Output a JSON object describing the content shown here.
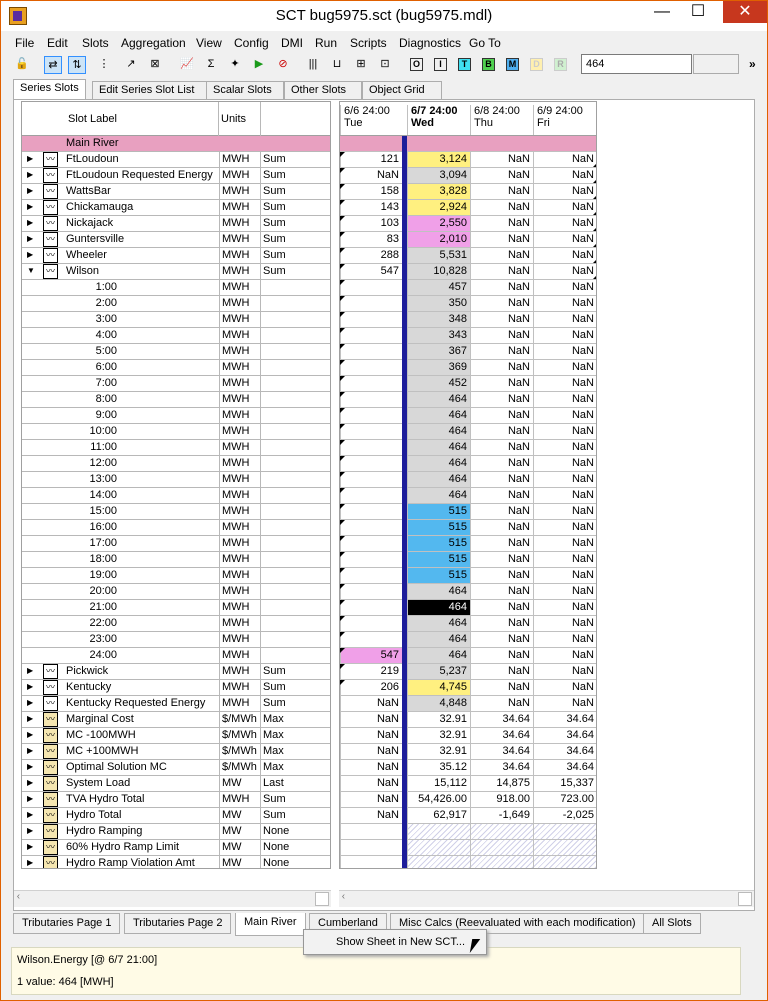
{
  "window": {
    "title": "SCT bug5975.sct (bug5975.mdl)",
    "min": "—",
    "max": "☐",
    "close": "✕"
  },
  "menu": [
    "File",
    "Edit",
    "Slots",
    "Aggregation",
    "View",
    "Config",
    "DMI",
    "Run",
    "Scripts",
    "Diagnostics",
    "Go To"
  ],
  "toolbar": {
    "search_value": "464",
    "boxes": [
      "O",
      "I",
      "T",
      "B",
      "M",
      "D",
      "R"
    ]
  },
  "top_tabs": [
    "Series Slots",
    "Edit Series Slot List",
    "Scalar Slots",
    "Other Slots",
    "Object Grid"
  ],
  "columns": {
    "slot_label": "Slot Label",
    "units": "Units"
  },
  "dates": [
    {
      "d": "6/6 24:00",
      "w": "Tue"
    },
    {
      "d": "6/7 24:00",
      "w": "Wed"
    },
    {
      "d": "6/8 24:00",
      "w": "Thu"
    },
    {
      "d": "6/9 24:00",
      "w": "Fri"
    }
  ],
  "rows": [
    {
      "label": "Main River",
      "type": "main"
    },
    {
      "label": "FtLoudoun",
      "units": "MWH",
      "agg": "Sum",
      "arrow": "▶",
      "icon": "n",
      "v": [
        "121",
        "3,124",
        "NaN",
        "NaN"
      ],
      "c1": "yellow"
    },
    {
      "label": "FtLoudoun Requested Energy",
      "units": "MWH",
      "agg": "Sum",
      "arrow": "▶",
      "icon": "n",
      "v": [
        "NaN",
        "3,094",
        "NaN",
        "NaN"
      ],
      "c1": ""
    },
    {
      "label": "WattsBar",
      "units": "MWH",
      "agg": "Sum",
      "arrow": "▶",
      "icon": "n",
      "v": [
        "158",
        "3,828",
        "NaN",
        "NaN"
      ],
      "c1": "yellow"
    },
    {
      "label": "Chickamauga",
      "units": "MWH",
      "agg": "Sum",
      "arrow": "▶",
      "icon": "n",
      "v": [
        "143",
        "2,924",
        "NaN",
        "NaN"
      ],
      "c1": "yellow"
    },
    {
      "label": "Nickajack",
      "units": "MWH",
      "agg": "Sum",
      "arrow": "▶",
      "icon": "n",
      "v": [
        "103",
        "2,550",
        "NaN",
        "NaN"
      ],
      "c1": "pink"
    },
    {
      "label": "Guntersville",
      "units": "MWH",
      "agg": "Sum",
      "arrow": "▶",
      "icon": "n",
      "v": [
        "83",
        "2,010",
        "NaN",
        "NaN"
      ],
      "c1": "pink"
    },
    {
      "label": "Wheeler",
      "units": "MWH",
      "agg": "Sum",
      "arrow": "▶",
      "icon": "n",
      "v": [
        "288",
        "5,531",
        "NaN",
        "NaN"
      ],
      "c1": ""
    },
    {
      "label": "Wilson",
      "units": "MWH",
      "agg": "Sum",
      "arrow": "▼",
      "icon": "n",
      "v": [
        "547",
        "10,828",
        "NaN",
        "NaN"
      ],
      "c1": ""
    },
    {
      "label": "1:00",
      "units": "MWH",
      "ts": 1,
      "v": [
        "",
        "457",
        "NaN",
        "NaN"
      ],
      "c1": ""
    },
    {
      "label": "2:00",
      "units": "MWH",
      "ts": 1,
      "v": [
        "",
        "350",
        "NaN",
        "NaN"
      ],
      "c1": ""
    },
    {
      "label": "3:00",
      "units": "MWH",
      "ts": 1,
      "v": [
        "",
        "348",
        "NaN",
        "NaN"
      ],
      "c1": ""
    },
    {
      "label": "4:00",
      "units": "MWH",
      "ts": 1,
      "v": [
        "",
        "343",
        "NaN",
        "NaN"
      ],
      "c1": ""
    },
    {
      "label": "5:00",
      "units": "MWH",
      "ts": 1,
      "v": [
        "",
        "367",
        "NaN",
        "NaN"
      ],
      "c1": ""
    },
    {
      "label": "6:00",
      "units": "MWH",
      "ts": 1,
      "v": [
        "",
        "369",
        "NaN",
        "NaN"
      ],
      "c1": ""
    },
    {
      "label": "7:00",
      "units": "MWH",
      "ts": 1,
      "v": [
        "",
        "452",
        "NaN",
        "NaN"
      ],
      "c1": ""
    },
    {
      "label": "8:00",
      "units": "MWH",
      "ts": 1,
      "v": [
        "",
        "464",
        "NaN",
        "NaN"
      ],
      "c1": ""
    },
    {
      "label": "9:00",
      "units": "MWH",
      "ts": 1,
      "v": [
        "",
        "464",
        "NaN",
        "NaN"
      ],
      "c1": ""
    },
    {
      "label": "10:00",
      "units": "MWH",
      "ts": 1,
      "v": [
        "",
        "464",
        "NaN",
        "NaN"
      ],
      "c1": ""
    },
    {
      "label": "11:00",
      "units": "MWH",
      "ts": 1,
      "v": [
        "",
        "464",
        "NaN",
        "NaN"
      ],
      "c1": ""
    },
    {
      "label": "12:00",
      "units": "MWH",
      "ts": 1,
      "v": [
        "",
        "464",
        "NaN",
        "NaN"
      ],
      "c1": ""
    },
    {
      "label": "13:00",
      "units": "MWH",
      "ts": 1,
      "v": [
        "",
        "464",
        "NaN",
        "NaN"
      ],
      "c1": ""
    },
    {
      "label": "14:00",
      "units": "MWH",
      "ts": 1,
      "v": [
        "",
        "464",
        "NaN",
        "NaN"
      ],
      "c1": ""
    },
    {
      "label": "15:00",
      "units": "MWH",
      "ts": 1,
      "v": [
        "",
        "515",
        "NaN",
        "NaN"
      ],
      "c1": "blue"
    },
    {
      "label": "16:00",
      "units": "MWH",
      "ts": 1,
      "v": [
        "",
        "515",
        "NaN",
        "NaN"
      ],
      "c1": "blue"
    },
    {
      "label": "17:00",
      "units": "MWH",
      "ts": 1,
      "v": [
        "",
        "515",
        "NaN",
        "NaN"
      ],
      "c1": "blue"
    },
    {
      "label": "18:00",
      "units": "MWH",
      "ts": 1,
      "v": [
        "",
        "515",
        "NaN",
        "NaN"
      ],
      "c1": "blue"
    },
    {
      "label": "19:00",
      "units": "MWH",
      "ts": 1,
      "v": [
        "",
        "515",
        "NaN",
        "NaN"
      ],
      "c1": "blue"
    },
    {
      "label": "20:00",
      "units": "MWH",
      "ts": 1,
      "v": [
        "",
        "464",
        "NaN",
        "NaN"
      ],
      "c1": ""
    },
    {
      "label": "21:00",
      "units": "MWH",
      "ts": 1,
      "v": [
        "",
        "464",
        "NaN",
        "NaN"
      ],
      "c1": "black"
    },
    {
      "label": "22:00",
      "units": "MWH",
      "ts": 1,
      "v": [
        "",
        "464",
        "NaN",
        "NaN"
      ],
      "c1": ""
    },
    {
      "label": "23:00",
      "units": "MWH",
      "ts": 1,
      "v": [
        "",
        "464",
        "NaN",
        "NaN"
      ],
      "c1": ""
    },
    {
      "label": "24:00",
      "units": "MWH",
      "ts": 1,
      "v": [
        "547",
        "464",
        "NaN",
        "NaN"
      ],
      "c1": "",
      "c0": "pinkdot"
    },
    {
      "label": "Pickwick",
      "units": "MWH",
      "agg": "Sum",
      "arrow": "▶",
      "icon": "n",
      "v": [
        "219",
        "5,237",
        "NaN",
        "NaN"
      ],
      "c1": ""
    },
    {
      "label": "Kentucky",
      "units": "MWH",
      "agg": "Sum",
      "arrow": "▶",
      "icon": "n",
      "v": [
        "206",
        "4,745",
        "NaN",
        "NaN"
      ],
      "c1": "yellow"
    },
    {
      "label": "Kentucky Requested Energy",
      "units": "MWH",
      "agg": "Sum",
      "arrow": "▶",
      "icon": "n",
      "v": [
        "NaN",
        "4,848",
        "NaN",
        "NaN"
      ],
      "c1": ""
    },
    {
      "label": "Marginal Cost",
      "units": "$/MWh",
      "agg": "Max",
      "arrow": "▶",
      "icon": "y",
      "v": [
        "NaN",
        "32.91",
        "34.64",
        "34.64"
      ],
      "c1": "white"
    },
    {
      "label": "MC -100MWH",
      "units": "$/MWh",
      "agg": "Max",
      "arrow": "▶",
      "icon": "y",
      "v": [
        "NaN",
        "32.91",
        "34.64",
        "34.64"
      ],
      "c1": "white"
    },
    {
      "label": "MC +100MWH",
      "units": "$/MWh",
      "agg": "Max",
      "arrow": "▶",
      "icon": "y",
      "v": [
        "NaN",
        "32.91",
        "34.64",
        "34.64"
      ],
      "c1": "white"
    },
    {
      "label": "Optimal Solution MC",
      "units": "$/MWh",
      "agg": "Max",
      "arrow": "▶",
      "icon": "y",
      "v": [
        "NaN",
        "35.12",
        "34.64",
        "34.64"
      ],
      "c1": "white"
    },
    {
      "label": "System Load",
      "units": "MW",
      "agg": "Last",
      "arrow": "▶",
      "icon": "y",
      "v": [
        "NaN",
        "15,112",
        "14,875",
        "15,337"
      ],
      "c1": "white"
    },
    {
      "label": "TVA Hydro Total",
      "units": "MWH",
      "agg": "Sum",
      "arrow": "▶",
      "icon": "y",
      "v": [
        "NaN",
        "54,426.00",
        "918.00",
        "723.00"
      ],
      "c1": "white"
    },
    {
      "label": "Hydro Total",
      "units": "MW",
      "agg": "Sum",
      "arrow": "▶",
      "icon": "y",
      "v": [
        "NaN",
        "62,917",
        "-1,649",
        "-2,025"
      ],
      "c1": "white"
    },
    {
      "label": "Hydro Ramping",
      "units": "MW",
      "agg": "None",
      "arrow": "▶",
      "icon": "y",
      "v": [
        "",
        "",
        "",
        ""
      ],
      "c1": "hatch"
    },
    {
      "label": "60% Hydro Ramp Limit",
      "units": "MW",
      "agg": "None",
      "arrow": "▶",
      "icon": "y",
      "v": [
        "",
        "",
        "",
        ""
      ],
      "c1": "hatch"
    },
    {
      "label": "Hydro Ramp Violation Amt",
      "units": "MW",
      "agg": "None",
      "arrow": "▶",
      "icon": "y",
      "v": [
        "",
        "",
        "",
        ""
      ],
      "c1": "hatch"
    }
  ],
  "bottom_tabs": [
    "Tributaries Page 1",
    "Tributaries Page 2",
    "Main River",
    "Cumberland",
    "Misc Calcs (Reevaluated with each modification)",
    "All Slots"
  ],
  "popup": {
    "item": "Show Sheet in New SCT..."
  },
  "status": {
    "line1": "Wilson.Energy [@ 6/7 21:00]",
    "line2": "1 value:  464 [MWH]"
  }
}
